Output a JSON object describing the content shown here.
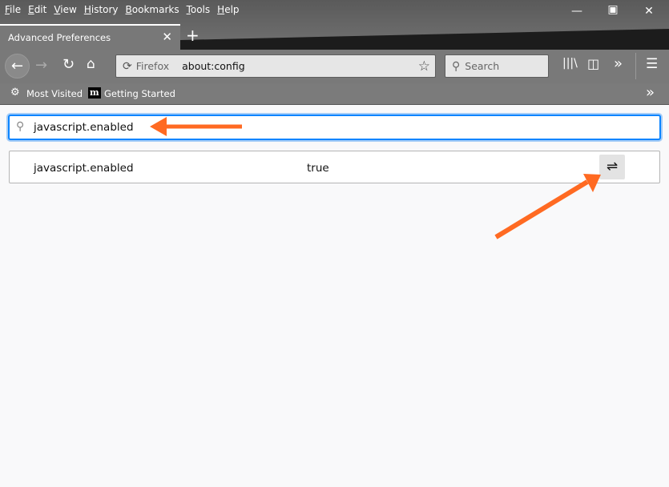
{
  "menu": [
    "File",
    "Edit",
    "View",
    "History",
    "Bookmarks",
    "Tools",
    "Help"
  ],
  "tab": {
    "title": "Advanced Preferences"
  },
  "urlbar": {
    "identity": "Firefox",
    "url": "about:config"
  },
  "search": {
    "placeholder": "Search"
  },
  "bookmarks": [
    "Most Visited",
    "Getting Started"
  ],
  "config": {
    "filter": "javascript.enabled",
    "pref_name": "javascript.enabled",
    "pref_value": "true"
  },
  "colors": {
    "annotation_arrow": "#ff6a22",
    "focus": "#0a84ff"
  }
}
